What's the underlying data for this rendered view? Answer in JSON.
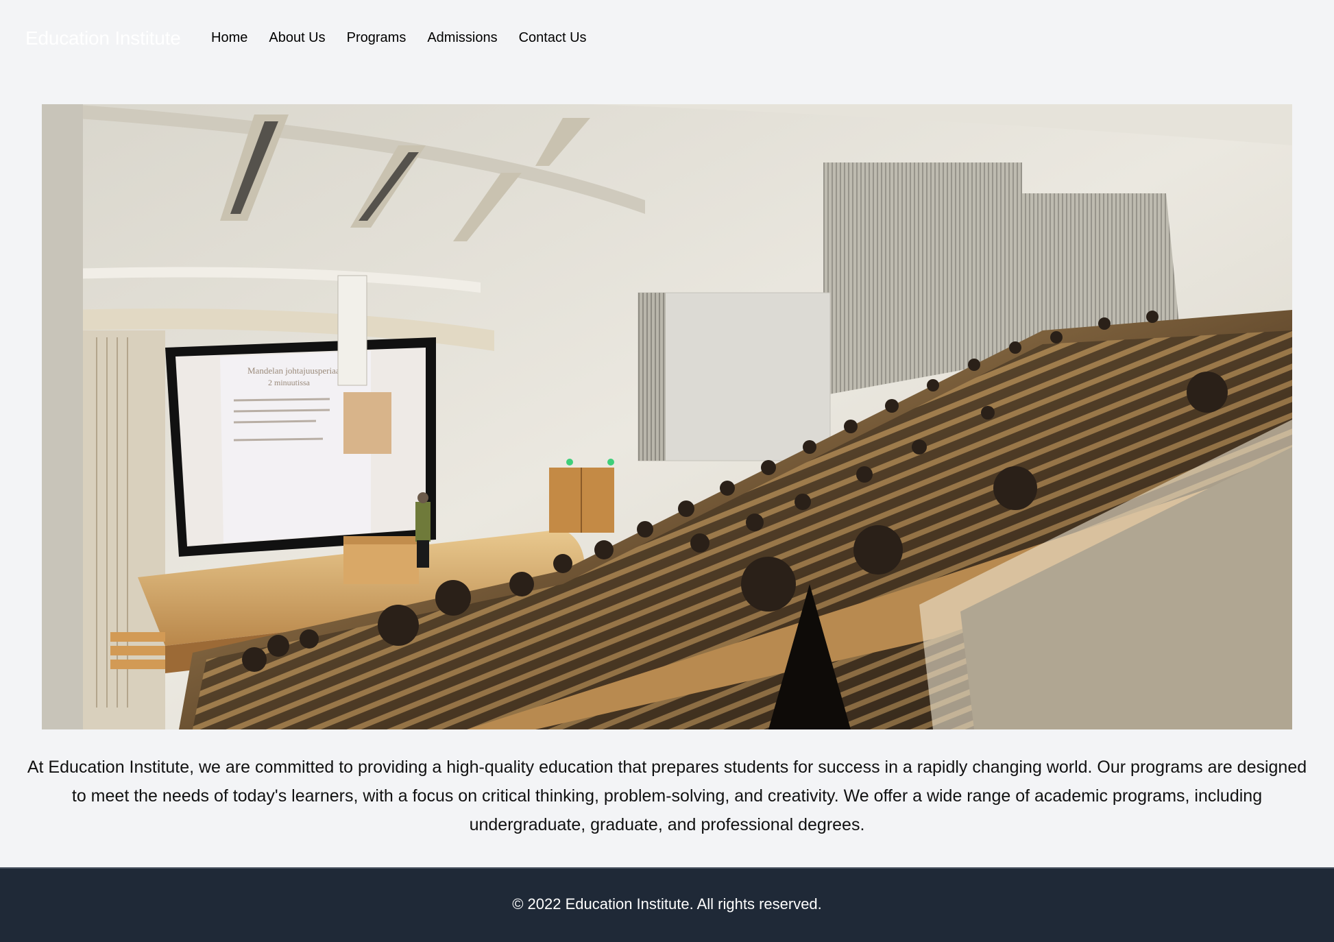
{
  "header": {
    "logo": "Education Institute",
    "nav": [
      {
        "label": "Home"
      },
      {
        "label": "About Us"
      },
      {
        "label": "Programs"
      },
      {
        "label": "Admissions"
      },
      {
        "label": "Contact Us"
      }
    ]
  },
  "hero": {
    "image_alt": "Lecture hall with students attending a presentation",
    "screen_slide_title": "Mandelan johtajuusperiaatteet",
    "screen_slide_subtitle": "2 minuutissa"
  },
  "main": {
    "intro": "At Education Institute, we are committed to providing a high-quality education that prepares students for success in a rapidly changing world. Our programs are designed to meet the needs of today's learners, with a focus on critical thinking, problem-solving, and creativity. We offer a wide range of academic programs, including undergraduate, graduate, and professional degrees."
  },
  "footer": {
    "copyright": "© 2022 Education Institute. All rights reserved."
  },
  "colors": {
    "page_background": "#f3f4f6",
    "footer_background": "#1f2937",
    "logo_text": "#ffffff",
    "nav_text": "#000000"
  }
}
